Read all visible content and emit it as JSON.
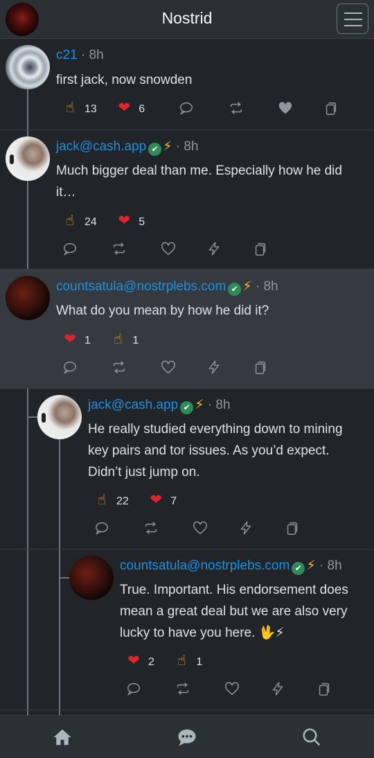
{
  "header": {
    "title": "Nostrid"
  },
  "posts": [
    {
      "name": "c21",
      "time": "· 8h",
      "verified": false,
      "bolt": false,
      "text": "first jack, now snowden",
      "reactions": [
        {
          "emoji": "point",
          "count": "13"
        },
        {
          "emoji": "heart",
          "count": "6"
        }
      ]
    },
    {
      "name": "jack@cash.app",
      "time": "· 8h",
      "verified": true,
      "bolt": true,
      "text": "Much bigger deal than me. Especially how he did it…",
      "reactions": [
        {
          "emoji": "point",
          "count": "24"
        },
        {
          "emoji": "heart",
          "count": "5"
        }
      ]
    },
    {
      "name": "countsatula@nostrplebs.com",
      "time": "· 8h",
      "verified": true,
      "bolt": true,
      "text": "What do you mean by how he did it?",
      "reactions": [
        {
          "emoji": "heart",
          "count": "1"
        },
        {
          "emoji": "point",
          "count": "1"
        }
      ]
    },
    {
      "name": "jack@cash.app",
      "time": "· 8h",
      "verified": true,
      "bolt": true,
      "text": "He really studied everything down to mining key pairs and tor issues. As you’d expect. Didn’t just jump on.",
      "reactions": [
        {
          "emoji": "point",
          "count": "22"
        },
        {
          "emoji": "heart",
          "count": "7"
        }
      ]
    },
    {
      "name": "countsatula@nostrplebs.com",
      "time": "· 8h",
      "verified": true,
      "bolt": true,
      "text": "True. Important. His endorsement does mean a great deal but we are also very lucky to have you here. 🖖⚡",
      "reactions": [
        {
          "emoji": "heart",
          "count": "2"
        },
        {
          "emoji": "point",
          "count": "1"
        }
      ]
    }
  ],
  "icons": {
    "verified": "✔",
    "bolt": "⚡",
    "heart": "❤",
    "point": "☝"
  },
  "colors": {
    "link": "#1d8fe0",
    "verified": "#2e8b57",
    "bolt": "#f2c230",
    "heart": "#e0242b",
    "bg": "#212529",
    "highlight": "#343a40"
  }
}
